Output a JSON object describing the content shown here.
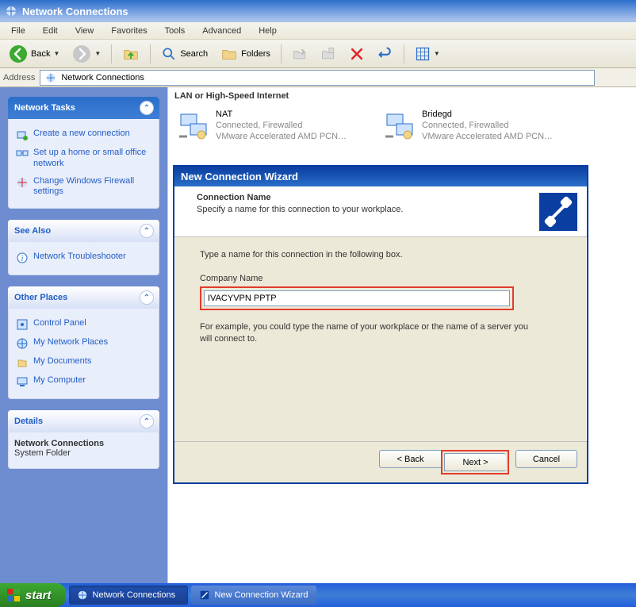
{
  "titlebar": {
    "title": "Network Connections"
  },
  "menubar": {
    "items": [
      "File",
      "Edit",
      "View",
      "Favorites",
      "Tools",
      "Advanced",
      "Help"
    ]
  },
  "toolbar": {
    "back": "Back",
    "search": "Search",
    "folders": "Folders"
  },
  "addressbar": {
    "label": "Address",
    "value": "Network Connections"
  },
  "sidebar": {
    "network_tasks": {
      "title": "Network Tasks",
      "items": [
        "Create a new connection",
        "Set up a home or small office network",
        "Change Windows Firewall settings"
      ]
    },
    "see_also": {
      "title": "See Also",
      "items": [
        "Network Troubleshooter"
      ]
    },
    "other_places": {
      "title": "Other Places",
      "items": [
        "Control Panel",
        "My Network Places",
        "My Documents",
        "My Computer"
      ]
    },
    "details": {
      "title": "Details",
      "name": "Network Connections",
      "type": "System Folder"
    }
  },
  "content": {
    "section_title": "LAN or High-Speed Internet",
    "connections": [
      {
        "name": "NAT",
        "status": "Connected, Firewalled",
        "device": "VMware Accelerated AMD PCN…"
      },
      {
        "name": "Bridegd",
        "status": "Connected, Firewalled",
        "device": "VMware Accelerated AMD PCN…"
      }
    ]
  },
  "wizard": {
    "title": "New Connection Wizard",
    "heading": "Connection Name",
    "subheading": "Specify a name for this connection to your workplace.",
    "instruction": "Type a name for this connection in the following box.",
    "field_label": "Company Name",
    "field_value": "IVACYVPN PPTP",
    "hint": "For example, you could type the name of your workplace or the name of a server you will connect to.",
    "buttons": {
      "back": "< Back",
      "next": "Next >",
      "cancel": "Cancel"
    }
  },
  "taskbar": {
    "start": "start",
    "tasks": [
      "Network Connections",
      "New Connection Wizard"
    ]
  }
}
